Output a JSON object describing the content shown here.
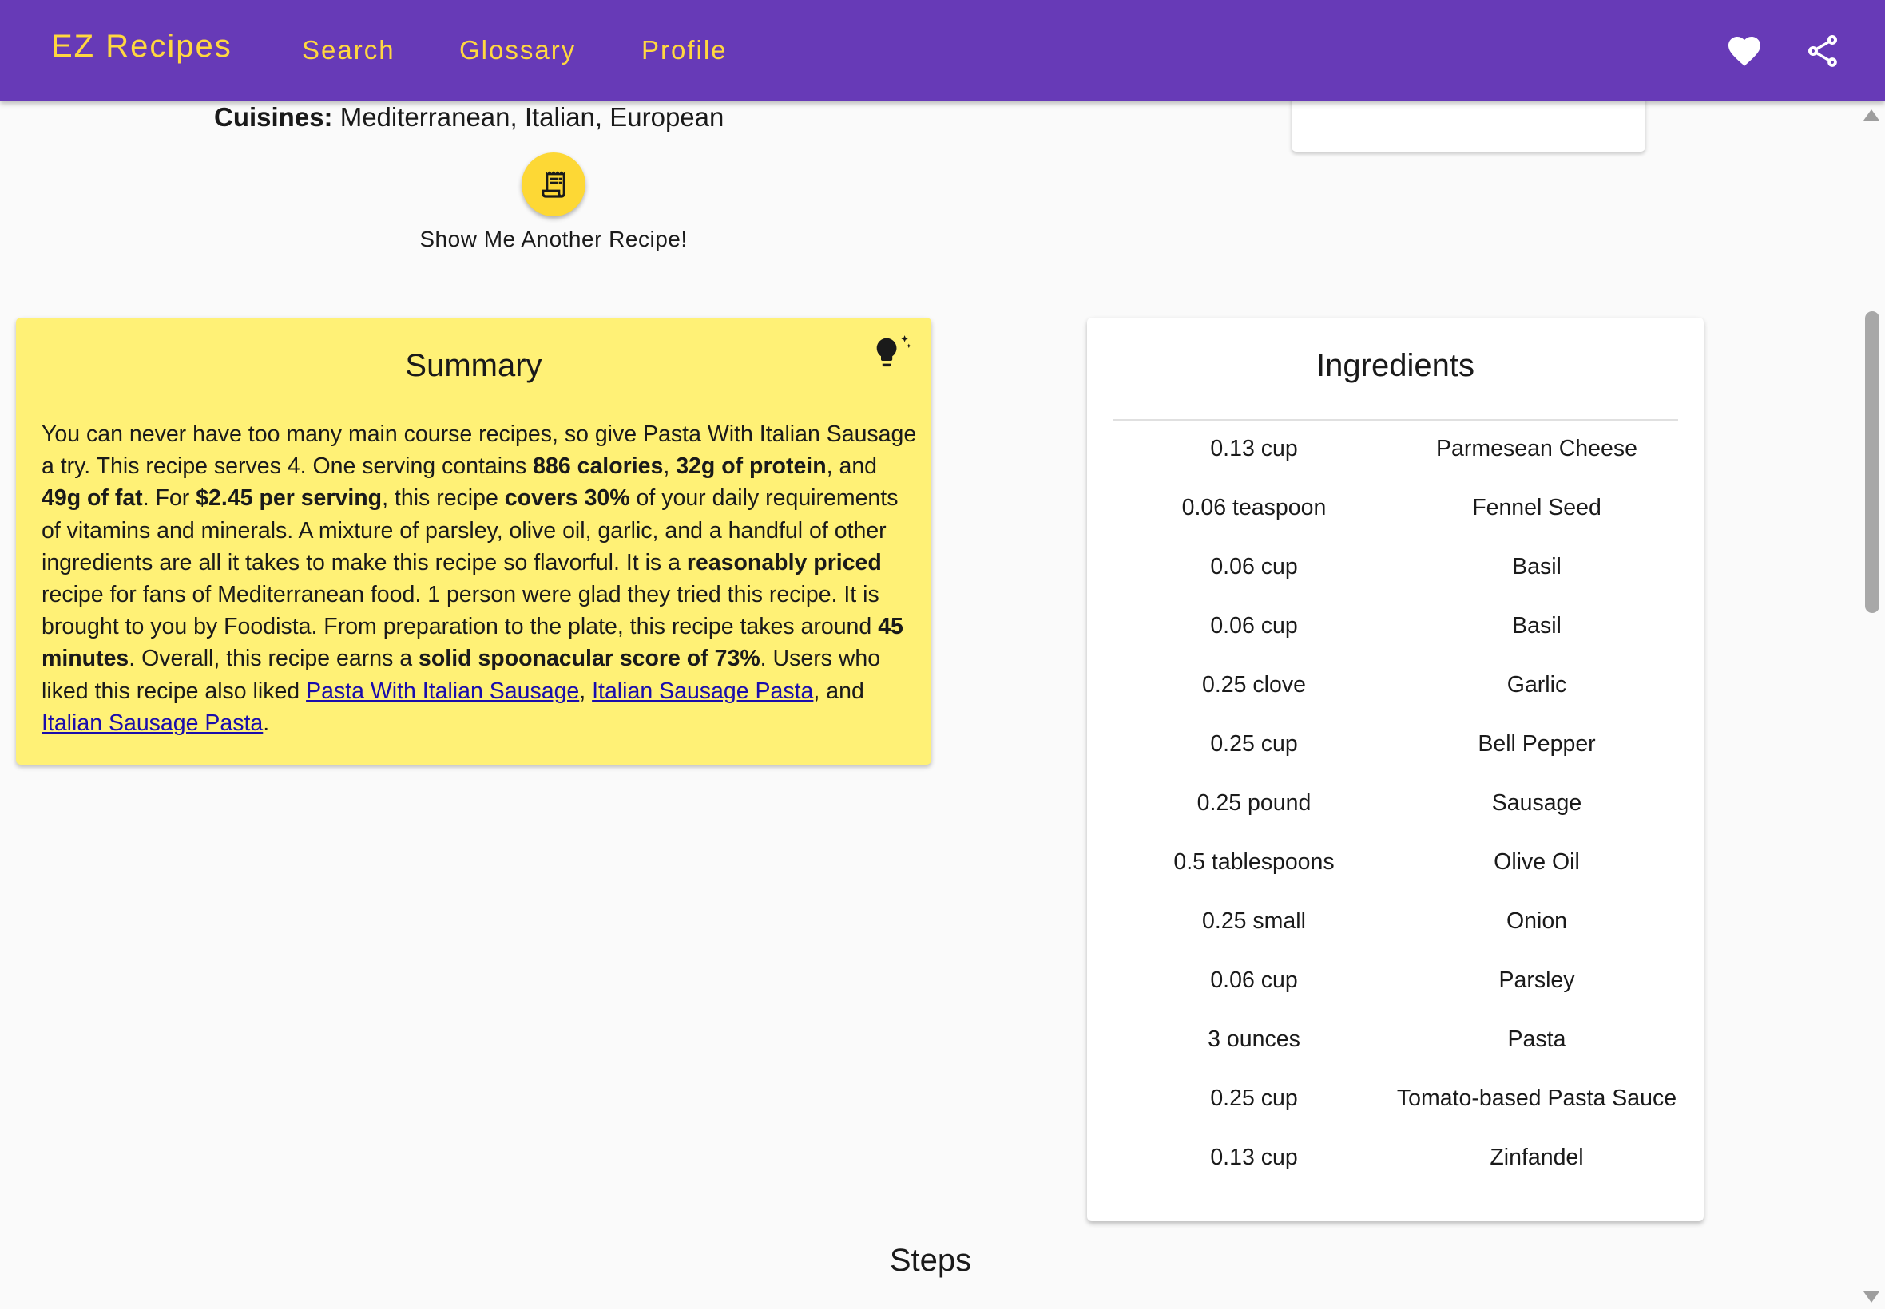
{
  "navbar": {
    "brand": "EZ Recipes",
    "links": [
      "Search",
      "Glossary",
      "Profile"
    ],
    "icons": [
      "heart-icon",
      "share-icon"
    ],
    "background": "#673ab7",
    "accent": "#ffd740"
  },
  "recipe": {
    "cuisines_label": "Cuisines:",
    "cuisines_value": " Mediterranean, Italian, European",
    "another_recipe_label": "Show Me Another Recipe!"
  },
  "summary": {
    "title": "Summary",
    "t1": "You can never have too many main course recipes, so give Pasta With Italian Sausage a try. This recipe serves 4. One serving contains ",
    "b_calories": "886 calories",
    "t2": ", ",
    "b_protein": "32g of protein",
    "t3": ", and ",
    "b_fat": "49g of fat",
    "t4": ". For ",
    "b_price": "$2.45 per serving",
    "t5": ", this recipe ",
    "b_covers": "covers 30%",
    "t6": " of your daily requirements of vitamins and minerals. A mixture of parsley, olive oil, garlic, and a handful of other ingredients are all it takes to make this recipe so flavorful. It is a ",
    "b_priced": "reasonably priced",
    "t7": " recipe for fans of Mediterranean food. 1 person were glad they tried this recipe. It is brought to you by Foodista. From preparation to the plate, this recipe takes around ",
    "b_time": "45 minutes",
    "t8": ". Overall, this recipe earns a ",
    "b_score": "solid spoonacular score of 73%",
    "t9": ". Users who liked this recipe also liked ",
    "link1": "Pasta With Italian Sausage",
    "t10": ", ",
    "link2": "Italian Sausage Pasta",
    "t11": ", and ",
    "link3": "Italian Sausage Pasta",
    "t12": ".",
    "background": "#fff176"
  },
  "ingredients": {
    "title": "Ingredients",
    "items": [
      {
        "amount": "0.13 cup",
        "name": "Parmesean Cheese"
      },
      {
        "amount": "0.06 teaspoon",
        "name": "Fennel Seed"
      },
      {
        "amount": "0.06 cup",
        "name": "Basil"
      },
      {
        "amount": "0.06 cup",
        "name": "Basil"
      },
      {
        "amount": "0.25 clove",
        "name": "Garlic"
      },
      {
        "amount": "0.25 cup",
        "name": "Bell Pepper"
      },
      {
        "amount": "0.25 pound",
        "name": "Sausage"
      },
      {
        "amount": "0.5 tablespoons",
        "name": "Olive Oil"
      },
      {
        "amount": "0.25 small",
        "name": "Onion"
      },
      {
        "amount": "0.06 cup",
        "name": "Parsley"
      },
      {
        "amount": "3 ounces",
        "name": "Pasta"
      },
      {
        "amount": "0.25 cup",
        "name": "Tomato-based Pasta Sauce"
      },
      {
        "amount": "0.13 cup",
        "name": "Zinfandel"
      }
    ]
  },
  "steps": {
    "title": "Steps"
  }
}
